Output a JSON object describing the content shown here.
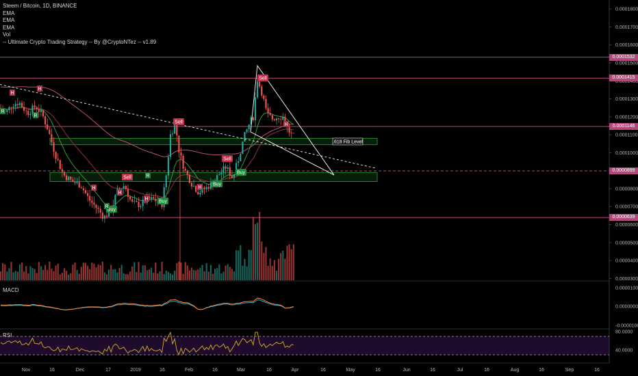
{
  "chart_data": {
    "type": "candlestick",
    "title": "Steem / Bitcoin, 1D, BINANCE",
    "indicators": [
      "EMA",
      "EMA",
      "EMA",
      "Vol",
      "-- Ultimate Crypto Trading Strategy -- By @CryptoNTez -- v1.89"
    ],
    "y_axis": {
      "ticks": [
        "0.0001800",
        "0.0001700",
        "0.0001600",
        "0.0001500",
        "0.0001400",
        "0.0001300",
        "0.0001200",
        "0.0001100",
        "0.0001000",
        "0.0000900",
        "0.0000800",
        "0.0000700",
        "0.0000600",
        "0.0000500",
        "0.0000400",
        "0.0000300"
      ],
      "range": [
        2.9e-05,
        0.000185
      ]
    },
    "x_axis": {
      "ticks": [
        "Nov",
        "16",
        "Dec",
        "17",
        "2019",
        "16",
        "Feb",
        "16",
        "Mar",
        "16",
        "Apr",
        "16",
        "May",
        "16",
        "Jun",
        "16",
        "Jul",
        "16",
        "Aug",
        "16",
        "Sep",
        "16"
      ]
    },
    "horizontal_levels": [
      {
        "value": 0.0001532,
        "label": "0.0001532",
        "color": "#b04a7a"
      },
      {
        "value": 0.0001415,
        "label": "0.0001415",
        "color": "#b04a7a"
      },
      {
        "value": 0.0001146,
        "label": "0.0001146",
        "color": "#b04a7a"
      },
      {
        "value": 8.99e-05,
        "label": "0.0000899",
        "color": "#b04a7a"
      },
      {
        "value": 6.39e-05,
        "label": "0.0000639",
        "color": "#b04a7a"
      }
    ],
    "zones": [
      {
        "low": 0.0001045,
        "high": 0.000108,
        "label": ".618 Fib Level",
        "color": "#1f8a2e"
      },
      {
        "low": 8.4e-05,
        "high": 8.9e-05,
        "label": "",
        "color": "#1f8a2e"
      }
    ],
    "signals": [
      {
        "text": "Sell",
        "type": "sell"
      },
      {
        "text": "Sell",
        "type": "sell"
      },
      {
        "text": "Sell",
        "type": "sell"
      },
      {
        "text": "Sell",
        "type": "sell"
      },
      {
        "text": "Buy",
        "type": "buy"
      },
      {
        "text": "Buy",
        "type": "buy"
      },
      {
        "text": "Buy",
        "type": "buy"
      },
      {
        "text": "Buy",
        "type": "buy"
      }
    ],
    "macd": {
      "label": "MACD",
      "ticks": [
        "0.0000100",
        "0.0000000",
        "-0.0000100"
      ]
    },
    "rsi": {
      "label": "RSI",
      "ticks": [
        "80.0000",
        "40.0000"
      ]
    },
    "colors": {
      "up": "#26a69a",
      "down": "#ef5350",
      "ema_fast": "#2e9e3a",
      "ema_mid": "#9c2f3c",
      "ema_slow": "#c0507a",
      "macd": "#ff8a3d",
      "signal": "#2aa9c9",
      "rsi": "#c9a227"
    }
  }
}
